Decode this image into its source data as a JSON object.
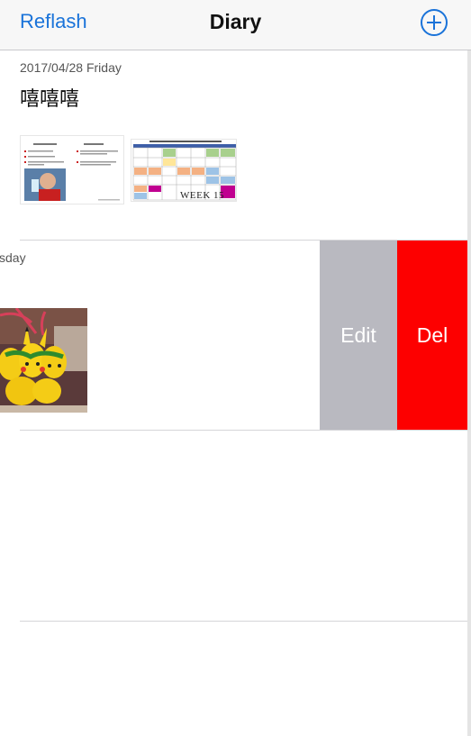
{
  "nav": {
    "left_label": "Reflash",
    "title": "Diary",
    "add_icon": "plus-circle-icon"
  },
  "entries": [
    {
      "date": "2017/04/28 Friday",
      "title": "嘻嘻嘻"
    },
    {
      "date_partial": "sday"
    }
  ],
  "thumbnails": {
    "slide_word_label": "WEEK 15"
  },
  "swipe_actions": {
    "edit_label": "Edit",
    "delete_label": "Del"
  },
  "colors": {
    "accent": "#1a73d9",
    "edit_bg": "#b9b9c0",
    "delete_bg": "#fd0000"
  }
}
